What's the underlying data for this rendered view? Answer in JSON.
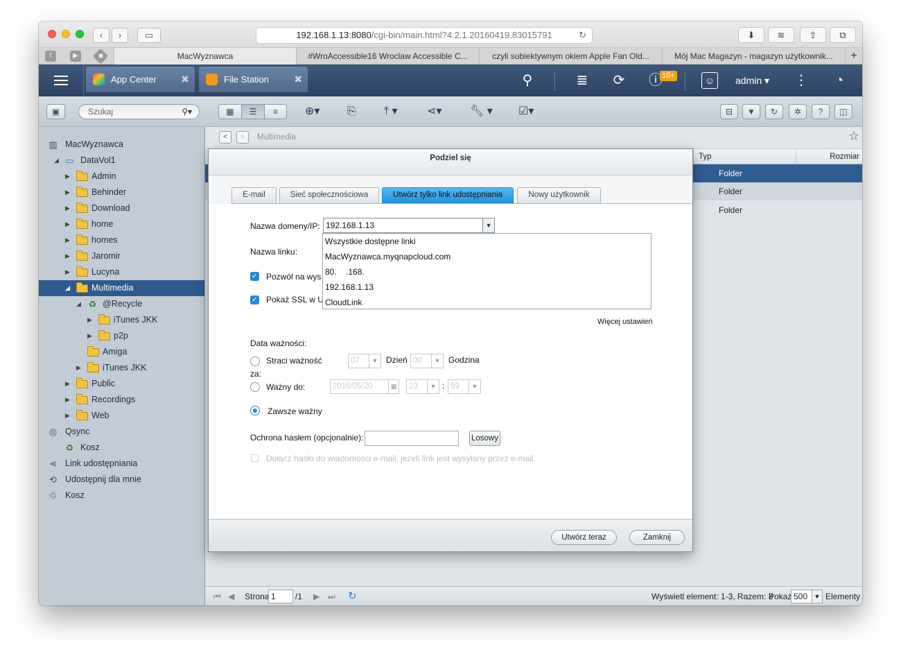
{
  "browser": {
    "url_host": "192.168.1.13:8080",
    "url_path": "/cgi-bin/main.html?4.2.1.20160419.83015791",
    "tabs": [
      "MacWyznawca",
      "#WroAccessible16 Wroclaw Accessible C...",
      "czyli subiektywnym okiem Apple Fan Old...",
      "Mój Mac Magazyn - magazyn użytkownik..."
    ],
    "new_tab": "+"
  },
  "qnap": {
    "app_tabs": [
      "App Center",
      "File Station"
    ],
    "notif_badge": "10+",
    "user": "admin"
  },
  "toolbar": {
    "search_placeholder": "Szukaj"
  },
  "sidebar": {
    "items": [
      {
        "label": "MacWyznawca"
      },
      {
        "label": "DataVol1"
      },
      {
        "label": "Admin"
      },
      {
        "label": "Behinder"
      },
      {
        "label": "Download"
      },
      {
        "label": "home"
      },
      {
        "label": "homes"
      },
      {
        "label": "Jaromir"
      },
      {
        "label": "Lucyna"
      },
      {
        "label": "Multimedia"
      },
      {
        "label": "@Recycle"
      },
      {
        "label": "iTunes JKK"
      },
      {
        "label": "p2p"
      },
      {
        "label": "Amiga"
      },
      {
        "label": "iTunes JKK"
      },
      {
        "label": "Public"
      },
      {
        "label": "Recordings"
      },
      {
        "label": "Web"
      },
      {
        "label": "Qsync"
      },
      {
        "label": "Kosz"
      },
      {
        "label": "Link udostępniania"
      },
      {
        "label": "Udostępnij dla mnie"
      },
      {
        "label": "Kosz"
      }
    ]
  },
  "main": {
    "breadcrumb": "Multimedia",
    "columns": {
      "type": "Typ",
      "size": "Rozmiar"
    },
    "rows": [
      {
        "type": "Folder"
      },
      {
        "type": "Folder"
      },
      {
        "type": "Folder"
      }
    ],
    "pager": {
      "page_label": "Strona",
      "page": "1",
      "total": "/1",
      "summary": "Wyświetl element: 1-3, Razem: 3",
      "show_label": "Pokaż",
      "per_page": "500",
      "items_label": "Elementy"
    }
  },
  "dialog": {
    "title": "Podziel się",
    "tabs": [
      "E-mail",
      "Sieć społecznościowa",
      "Utwórz tylko link udostępniania",
      "Nowy użytkownik"
    ],
    "domain_label": "Nazwa domeny/IP:",
    "domain_value": "192.168.1.13",
    "domain_options": [
      "Wszystkie dostępne linki",
      "MacWyznawca.myqnapcloud.com",
      "80.    .168.",
      "192.168.1.13",
      "CloudLink"
    ],
    "link_name_label": "Nazwa linku:",
    "allow_label": "Pozwól na wys",
    "ssl_label": "Pokaż SSL w U",
    "more_settings": "Więcej ustawień",
    "expiry_label": "Data ważności:",
    "expire_in_label": "Straci ważność",
    "expire_in_suffix": "za:",
    "expire_days": "07",
    "day_label": "Dzień",
    "expire_hours": "00",
    "hour_label": "Godzina",
    "valid_until_label": "Ważny do:",
    "valid_date": "2016/05/20",
    "valid_hour": "23",
    "time_sep": ":",
    "valid_min": "59",
    "always_label": "Zawsze ważny",
    "password_label": "Ochrona hasłem (opcjonalnie):",
    "random_button": "Losowy",
    "attach_password_label": "Dołącz hasło do wiadomości e-mail, jeżeli link jest wysyłany przez e-mail.",
    "create_button": "Utwórz teraz",
    "close_button": "Zamknij"
  }
}
